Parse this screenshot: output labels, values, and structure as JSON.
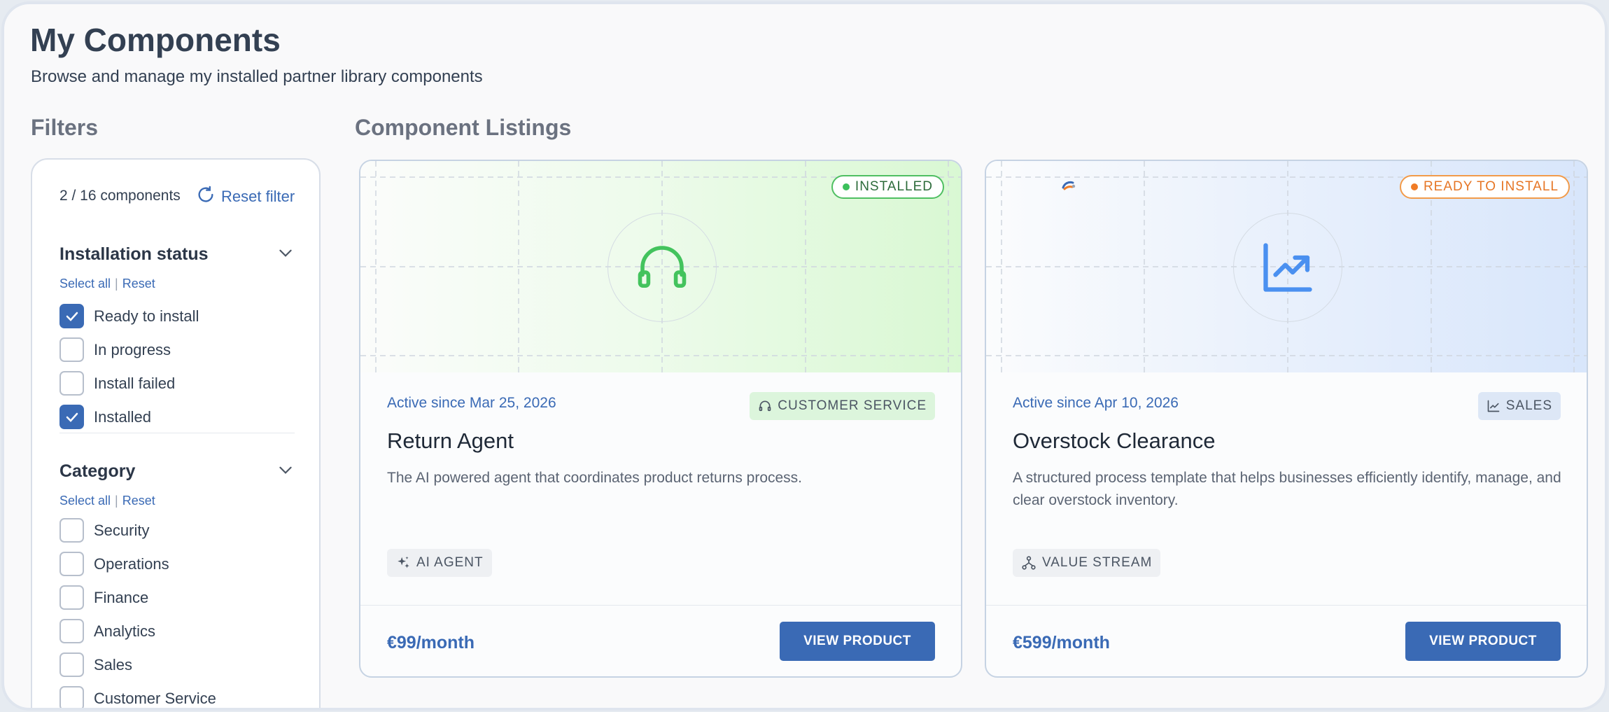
{
  "page": {
    "title": "My Components",
    "subtitle": "Browse and manage my installed partner library components"
  },
  "filters": {
    "heading": "Filters",
    "count_text": "2 / 16 components",
    "reset_filter_label": "Reset filter",
    "groups": [
      {
        "title": "Installation status",
        "select_all": "Select all",
        "reset": "Reset",
        "options": [
          {
            "label": "Ready to install",
            "checked": true
          },
          {
            "label": "In progress",
            "checked": false
          },
          {
            "label": "Install failed",
            "checked": false
          },
          {
            "label": "Installed",
            "checked": true
          }
        ]
      },
      {
        "title": "Category",
        "select_all": "Select all",
        "reset": "Reset",
        "options": [
          {
            "label": "Security",
            "checked": false
          },
          {
            "label": "Operations",
            "checked": false
          },
          {
            "label": "Finance",
            "checked": false
          },
          {
            "label": "Analytics",
            "checked": false
          },
          {
            "label": "Sales",
            "checked": false
          },
          {
            "label": "Customer Service",
            "checked": false
          }
        ]
      }
    ]
  },
  "listings": {
    "heading": "Component Listings",
    "cards": [
      {
        "status": "INSTALLED",
        "status_color": "#3cc05c",
        "hero_icon": "headset-icon",
        "active_since": "Active since Mar 25, 2026",
        "category": "CUSTOMER SERVICE",
        "category_icon": "headset-icon",
        "title": "Return Agent",
        "description": "The AI powered agent that coordinates product returns process.",
        "type": "AI AGENT",
        "type_icon": "sparkles-icon",
        "price": "€99/month",
        "button": "VIEW PRODUCT"
      },
      {
        "status": "READY TO INSTALL",
        "status_color": "#f07c26",
        "hero_icon": "trending-chart-icon",
        "active_since": "Active since Apr 10, 2026",
        "category": "SALES",
        "category_icon": "line-chart-icon",
        "title": "Overstock Clearance",
        "description": "A structured process template that helps businesses efficiently identify, manage, and clear overstock inventory.",
        "type": "VALUE STREAM",
        "type_icon": "hierarchy-icon",
        "price": "€599/month",
        "button": "VIEW PRODUCT"
      }
    ]
  },
  "colors": {
    "accent": "#3a6ab5",
    "installed_green": "#3cc05c",
    "ready_orange": "#f07c26"
  }
}
